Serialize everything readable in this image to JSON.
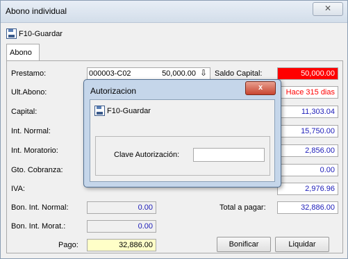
{
  "window": {
    "title": "Abono individual",
    "close_symbol": "✕"
  },
  "toolbar": {
    "save_label": "F10-Guardar"
  },
  "tabs": [
    {
      "label": "Abono"
    }
  ],
  "form": {
    "prestamo_label": "Prestamo:",
    "prestamo_value": "000003-C02",
    "prestamo_amount": "50,000.00",
    "ult_abono_label": "Ult.Abono:",
    "capital_label": "Capital:",
    "int_normal_label": "Int. Normal:",
    "int_moratorio_label": "Int. Moratorio:",
    "gto_cobranza_label": "Gto. Cobranza:",
    "iva_label": "IVA:",
    "bon_int_normal_label": "Bon. Int. Normal:",
    "bon_int_normal_value": "0.00",
    "bon_int_morat_label": "Bon. Int. Morat.:",
    "bon_int_morat_value": "0.00",
    "pago_label": "Pago:",
    "pago_value": "32,886.00",
    "saldo_capital_label": "Saldo Capital:",
    "saldo_capital_value": "50,000.00",
    "ultimo_abono_value": "Hace 315 dias",
    "capital_value": "11,303.04",
    "int_normal_value": "15,750.00",
    "int_moratorio_value": "2,856.00",
    "gto_cobranza_value": "0.00",
    "iva_value": "2,976.96",
    "total_label": "Total a pagar:",
    "total_value": "32,886.00"
  },
  "buttons": {
    "bonificar": "Bonificar",
    "liquidar": "Liquidar"
  },
  "dialog": {
    "title": "Autorizacion",
    "close_symbol": "x",
    "save_label": "F10-Guardar",
    "clave_label": "Clave Autorización:",
    "clave_value": ""
  },
  "colors": {
    "alert_red": "#ff0000",
    "value_blue": "#1b1bb8",
    "highlight_yellow": "#ffffc8"
  }
}
